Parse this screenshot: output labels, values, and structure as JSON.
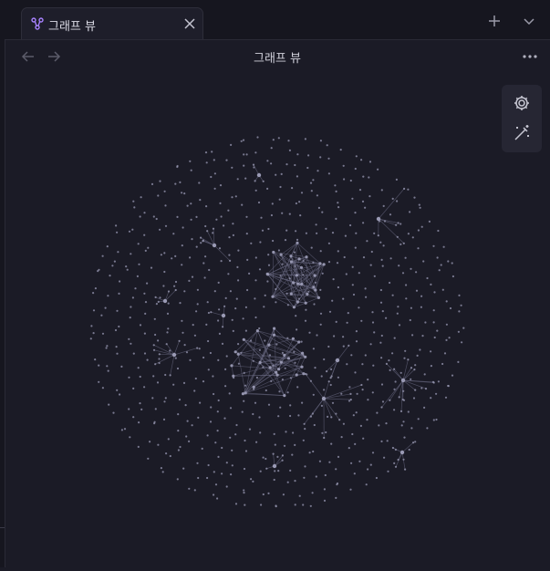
{
  "colors": {
    "background": "#1b1b26",
    "tabbar": "#16161f",
    "node": "#9a9ab4",
    "link": "#6e6e88",
    "accent": "#a882ff"
  },
  "banner_text": "",
  "tab": {
    "title": "그래프 뷰",
    "icon": "graph-icon"
  },
  "tabbar_actions": {
    "new_tab_icon": "plus-icon",
    "tab_list_icon": "chevron-down-icon"
  },
  "view": {
    "title": "그래프 뷰",
    "back_icon": "arrow-left-icon",
    "forward_icon": "arrow-right-icon",
    "more_icon": "more-horizontal-icon"
  },
  "graph_controls": {
    "settings_icon": "gear-icon",
    "animate_icon": "magic-wand-icon"
  }
}
